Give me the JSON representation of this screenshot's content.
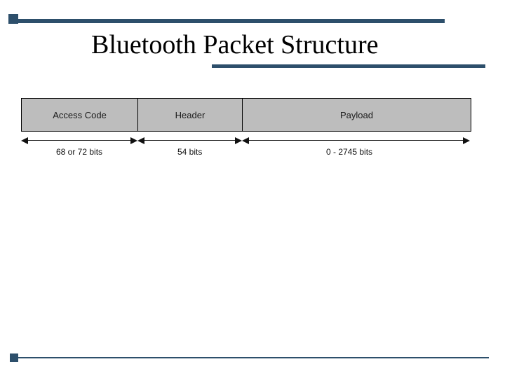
{
  "title": "Bluetooth Packet Structure",
  "packet": {
    "segments": [
      {
        "label": "Access Code",
        "size_text": "68 or 72 bits"
      },
      {
        "label": "Header",
        "size_text": "54 bits"
      },
      {
        "label": "Payload",
        "size_text": "0 - 2745 bits"
      }
    ]
  }
}
